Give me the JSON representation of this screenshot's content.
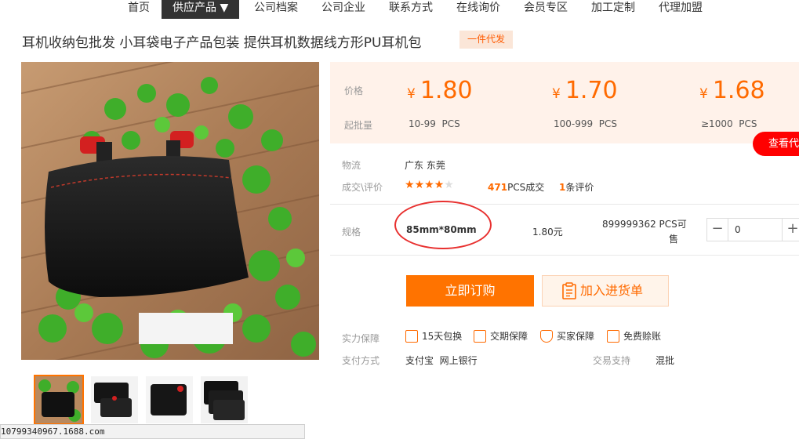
{
  "nav": {
    "items": [
      "首页",
      "供应产品 ▼",
      "公司档案",
      "公司企业",
      "联系方式",
      "在线询价",
      "会员专区",
      "加工定制",
      "代理加盟"
    ]
  },
  "product": {
    "title": "耳机收纳包批发 小耳袋电子产品包装 提供耳机数据线方形PU耳机包",
    "tag": "一件代发"
  },
  "price_box": {
    "price_label": "价格",
    "qty_label": "起批量",
    "tiers": [
      {
        "currency": "¥",
        "price": "1.80",
        "range": "10-99",
        "unit": "PCS"
      },
      {
        "currency": "¥",
        "price": "1.70",
        "range": "100-999",
        "unit": "PCS"
      },
      {
        "currency": "¥",
        "price": "1.68",
        "range": "≥1000",
        "unit": "PCS"
      }
    ],
    "agent_button": "查看代"
  },
  "logistics": {
    "label": "物流",
    "value": "广东 东莞"
  },
  "trade": {
    "label": "成交\\评价",
    "rating": 4,
    "rating_max": 5,
    "sold_count": "471",
    "sold_suffix": "PCS成交",
    "review_count": "1",
    "review_suffix": "条评价"
  },
  "spec": {
    "label": "规格",
    "name": "85mm*80mm",
    "price": "1.80元",
    "stock": "899999362 PCS可",
    "stock_line2": "售",
    "quantity": "0",
    "minus": "−",
    "plus": "+"
  },
  "actions": {
    "buy": "立即订购",
    "cart": "加入进货单"
  },
  "guarantee": {
    "label": "实力保障",
    "items": [
      "15天包换",
      "交期保障",
      "买家保障",
      "免费赊账"
    ]
  },
  "payment": {
    "label": "支付方式",
    "methods": "支付宝  网上银行",
    "support_label": "交易支持",
    "support_value": "混批"
  },
  "status_bar": {
    "url": "10799340967.1688.com"
  }
}
